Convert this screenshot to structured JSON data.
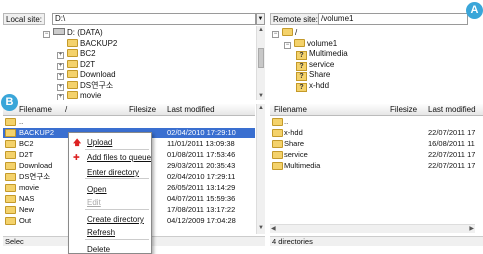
{
  "local": {
    "site_label": "Local site:",
    "site_value": "D:\\",
    "tree": [
      {
        "label": "D: (DATA)",
        "kind": "drive",
        "exp": "−"
      },
      {
        "label": "BACKUP2",
        "kind": "folder",
        "exp": ""
      },
      {
        "label": "BC2",
        "kind": "folder",
        "exp": "+"
      },
      {
        "label": "D2T",
        "kind": "folder",
        "exp": "+"
      },
      {
        "label": "Download",
        "kind": "folder",
        "exp": "+"
      },
      {
        "label": "DS연구소",
        "kind": "folder",
        "exp": "+"
      },
      {
        "label": "movie",
        "kind": "folder",
        "exp": "+"
      }
    ],
    "columns": {
      "filename": "Filename",
      "sort": "/",
      "filesize": "Filesize",
      "modified": "Last modified"
    },
    "files": [
      {
        "name": "..",
        "size": "",
        "date": ""
      },
      {
        "name": "BACKUP2",
        "size": "",
        "date": "02/04/2010 17:29:10",
        "selected": true
      },
      {
        "name": "BC2",
        "size": "",
        "date": "11/01/2011 13:09:38"
      },
      {
        "name": "D2T",
        "size": "",
        "date": "01/08/2011 17:53:46"
      },
      {
        "name": "Download",
        "size": "",
        "date": "29/03/2011 20:35:43"
      },
      {
        "name": "DS연구소",
        "size": "",
        "date": "02/04/2010 17:29:11"
      },
      {
        "name": "movie",
        "size": "",
        "date": "26/05/2011 13:14:29"
      },
      {
        "name": "NAS",
        "size": "",
        "date": "04/07/2011 15:59:36"
      },
      {
        "name": "New",
        "size": "",
        "date": "17/08/2011 13:17:22"
      },
      {
        "name": "Out",
        "size": "",
        "date": "04/12/2009 17:04:28"
      }
    ],
    "status": "Selec"
  },
  "remote": {
    "site_label": "Remote site:",
    "site_value": "/volume1",
    "tree": [
      {
        "label": "/",
        "kind": "folder",
        "exp": "−"
      },
      {
        "label": "volume1",
        "kind": "folder",
        "exp": "−"
      },
      {
        "label": "Multimedia",
        "kind": "qfolder",
        "exp": ""
      },
      {
        "label": "service",
        "kind": "qfolder",
        "exp": ""
      },
      {
        "label": "Share",
        "kind": "qfolder",
        "exp": ""
      },
      {
        "label": "x-hdd",
        "kind": "qfolder",
        "exp": ""
      }
    ],
    "columns": {
      "filename": "Filename",
      "filesize": "Filesize",
      "modified": "Last modified"
    },
    "files": [
      {
        "name": "..",
        "size": "",
        "date": ""
      },
      {
        "name": "x-hdd",
        "size": "",
        "date": "22/07/2011 17"
      },
      {
        "name": "Share",
        "size": "",
        "date": "16/08/2011 11"
      },
      {
        "name": "service",
        "size": "",
        "date": "22/07/2011 17"
      },
      {
        "name": "Multimedia",
        "size": "",
        "date": "22/07/2011 17"
      }
    ],
    "status": "4 directories"
  },
  "context_menu": {
    "items": [
      {
        "label": "Upload",
        "icon": "upload-icon",
        "enabled": true
      },
      {
        "label": "Add files to queue",
        "icon": "queue-icon",
        "enabled": true
      },
      {
        "label": "Enter directory",
        "enabled": true
      },
      {
        "label": "Open",
        "enabled": true
      },
      {
        "label": "Edit",
        "enabled": false
      },
      {
        "label": "Create directory",
        "enabled": true
      },
      {
        "label": "Refresh",
        "enabled": true
      },
      {
        "label": "Delete",
        "enabled": true
      }
    ]
  },
  "badges": {
    "a": "A",
    "b": "B"
  },
  "colors": {
    "selection": "#3a6fd0",
    "badge": "#3aa6d9",
    "folder": "#f4d26b"
  }
}
